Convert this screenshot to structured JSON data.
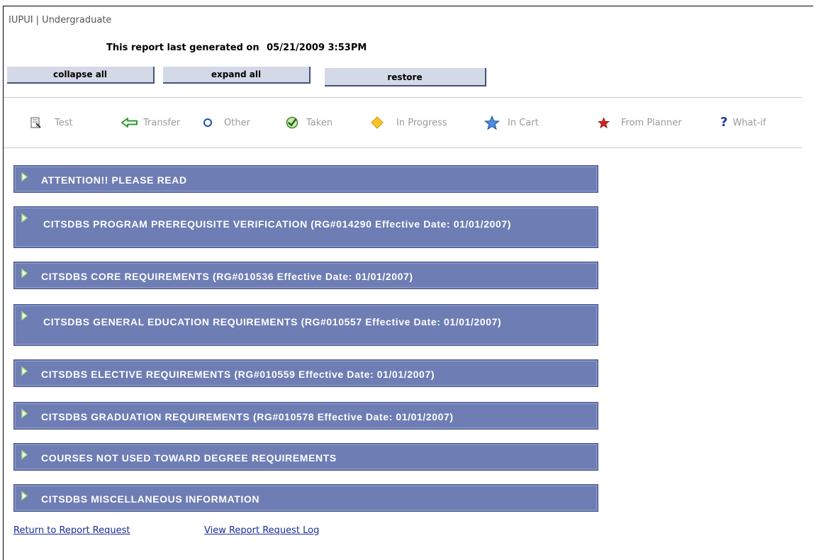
{
  "header": {
    "context": "IUPUI | Undergraduate",
    "generated_label": "This report last generated on",
    "generated_date": "05/21/2009 3:53PM"
  },
  "buttons": {
    "collapse_all": "collapse all",
    "expand_all": "expand all",
    "restore": "restore"
  },
  "legend": [
    {
      "label": "Test",
      "icon": "test-icon"
    },
    {
      "label": "Transfer",
      "icon": "transfer-arrow-icon"
    },
    {
      "label": "Other",
      "icon": "other-circle-icon"
    },
    {
      "label": "Taken",
      "icon": "taken-check-icon"
    },
    {
      "label": "In Progress",
      "icon": "in-progress-diamond-icon"
    },
    {
      "label": "In Cart",
      "icon": "in-cart-star-icon"
    },
    {
      "label": "From Planner",
      "icon": "from-planner-star-icon"
    },
    {
      "label": "What-if",
      "icon": "what-if-question-icon"
    }
  ],
  "sections": [
    {
      "title": "ATTENTION!! PLEASE READ"
    },
    {
      "title": "CITSDBS PROGRAM PREREQUISITE VERIFICATION (RG#014290 Effective Date: 01/01/2007)"
    },
    {
      "title": "CITSDBS CORE REQUIREMENTS (RG#010536 Effective Date: 01/01/2007)"
    },
    {
      "title": "CITSDBS GENERAL EDUCATION REQUIREMENTS (RG#010557 Effective Date: 01/01/2007)"
    },
    {
      "title": "CITSDBS ELECTIVE REQUIREMENTS (RG#010559 Effective Date: 01/01/2007)"
    },
    {
      "title": "CITSDBS GRADUATION REQUIREMENTS (RG#010578 Effective Date: 01/01/2007)"
    },
    {
      "title": "COURSES NOT USED TOWARD DEGREE REQUIREMENTS"
    },
    {
      "title": "CITSDBS MISCELLANEOUS INFORMATION"
    }
  ],
  "links": {
    "return": "Return to Report Request",
    "view_log": "View Report Request Log"
  },
  "colors": {
    "section_bar": "#6e7db4",
    "section_triangle": "#a8d87a",
    "button_bg": "#d3d9e6",
    "link": "#1a2d9c"
  }
}
